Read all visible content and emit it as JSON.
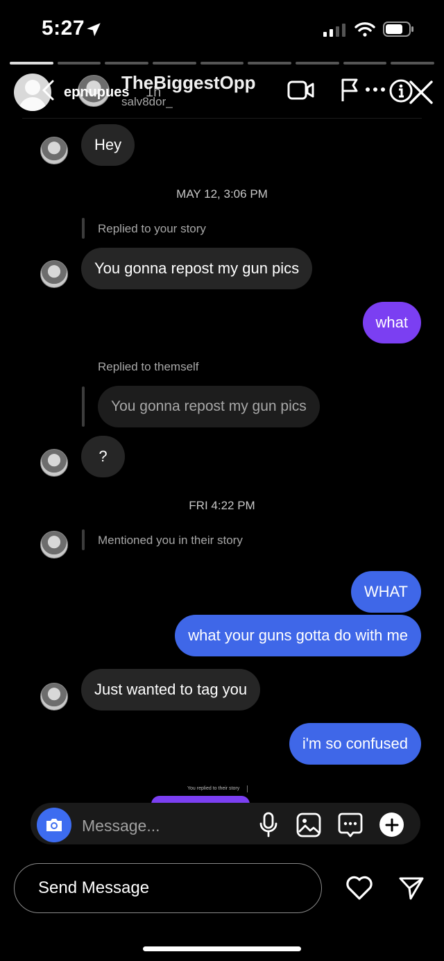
{
  "status_bar": {
    "time": "5:27"
  },
  "header": {
    "story_user": "epnupues",
    "story_time": "1h",
    "contact_name": "TheBiggestOpp",
    "contact_handle": "salv8dor_"
  },
  "messages": [
    {
      "kind": "in",
      "text": "Hey"
    },
    {
      "kind": "timestamp",
      "text": "MAY 12, 3:06 PM"
    },
    {
      "kind": "meta",
      "text": "Replied to your story"
    },
    {
      "kind": "in",
      "text": "You gonna repost my gun pics"
    },
    {
      "kind": "out",
      "text": "what"
    },
    {
      "kind": "meta",
      "text": "Replied to themself"
    },
    {
      "kind": "quote",
      "text": "You gonna repost my gun pics"
    },
    {
      "kind": "in",
      "text": "?"
    },
    {
      "kind": "timestamp",
      "text": "FRI 4:22 PM"
    },
    {
      "kind": "meta",
      "text": "Mentioned you in their story"
    },
    {
      "kind": "out",
      "text": "WHAT"
    },
    {
      "kind": "out",
      "text": "what your guns gotta do with me"
    },
    {
      "kind": "in",
      "text": "Just wanted to tag you"
    },
    {
      "kind": "out",
      "text": "i'm so confused"
    }
  ],
  "preview_caption": "You replied to their story",
  "composer": {
    "placeholder": "Message..."
  },
  "bottom": {
    "send_label": "Send Message"
  },
  "colors": {
    "purple": "#7b3ff2",
    "blue": "#3f67e8",
    "incoming": "#262626",
    "camera": "#3d6cf0"
  }
}
